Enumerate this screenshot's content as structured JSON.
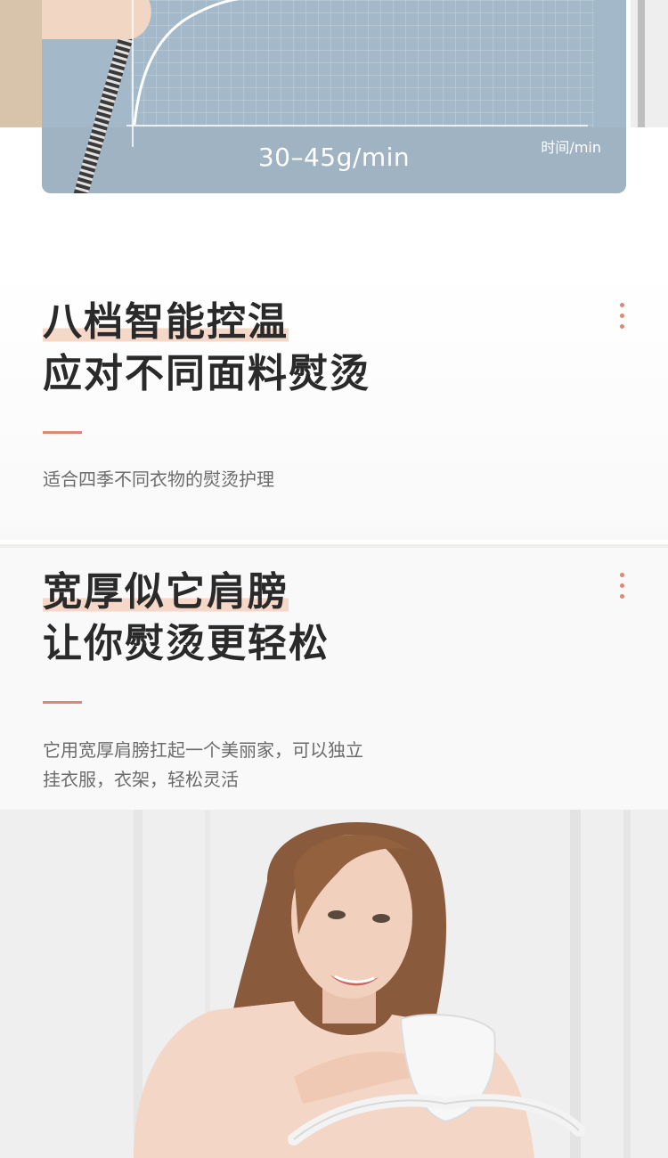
{
  "top_chart": {
    "rate_label": "30–45g/min",
    "axis_label": "时间/min"
  },
  "features": [
    {
      "title_line1": "八档智能控温",
      "title_line2": "应对不同面料熨烫",
      "description_lines": [
        "适合四季不同衣物的熨烫护理"
      ]
    },
    {
      "title_line1": "宽厚似它肩膀",
      "title_line2": "让你熨烫更轻松",
      "description_lines": [
        "它用宽厚肩膀扛起一个美丽家，可以独立",
        "挂衣服，衣架，轻松灵活"
      ]
    }
  ],
  "colors": {
    "accent": "#d98a72",
    "highlight": "#f6d8c9",
    "chart_bg": "#a3b8c8"
  }
}
